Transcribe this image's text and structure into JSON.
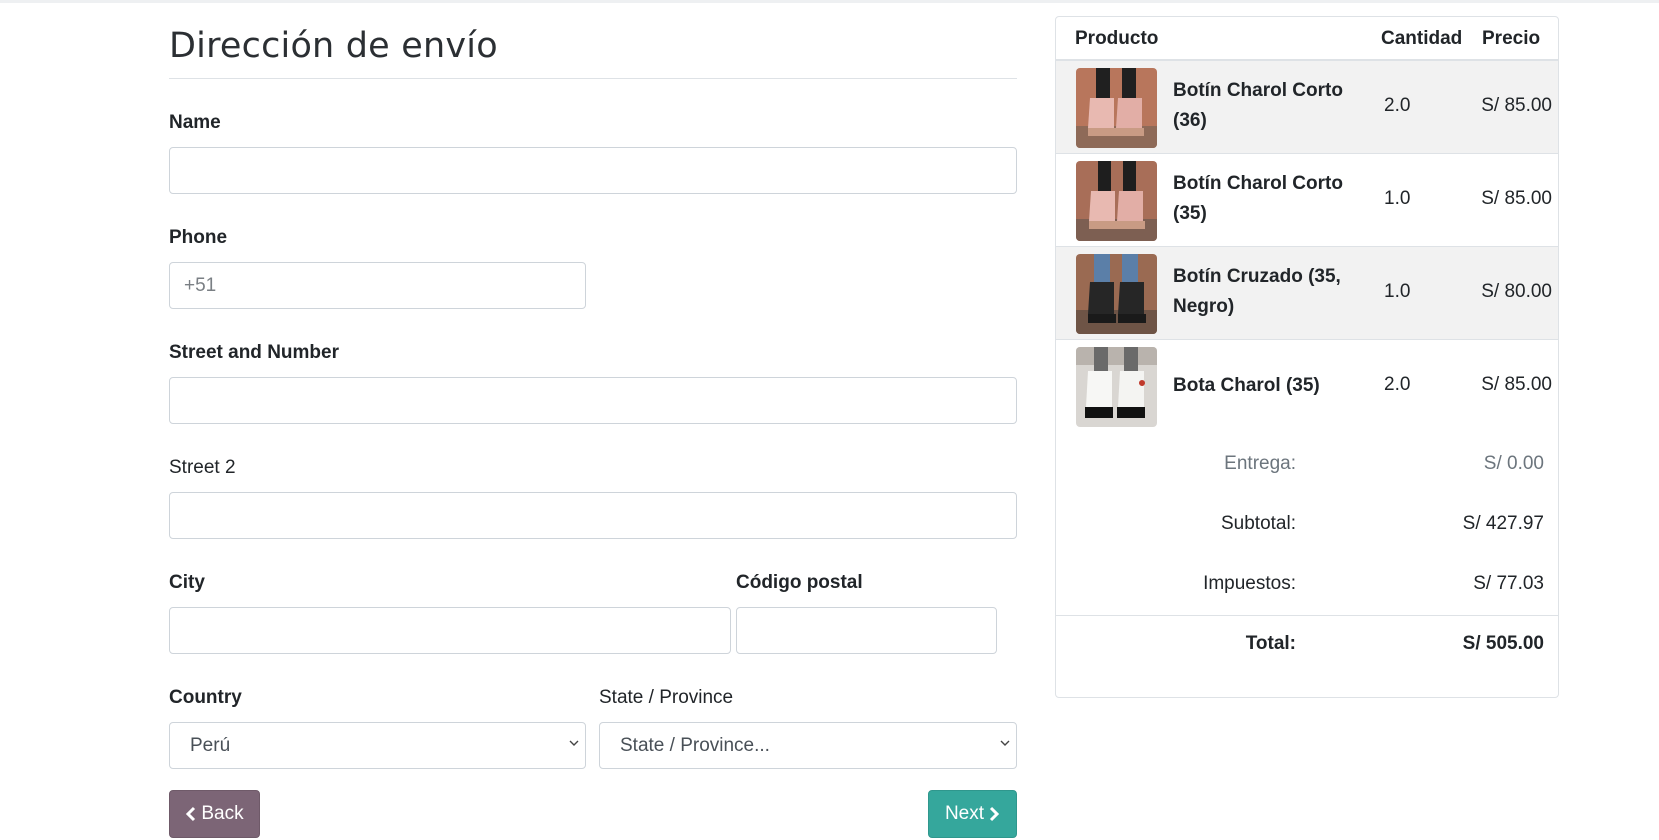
{
  "form": {
    "title": "Dirección de envío",
    "fields": {
      "name": {
        "label": "Name",
        "value": "",
        "placeholder": ""
      },
      "phone": {
        "label": "Phone",
        "value": "",
        "placeholder": "+51"
      },
      "street": {
        "label": "Street and Number",
        "value": "",
        "placeholder": ""
      },
      "street2": {
        "label": "Street 2",
        "value": "",
        "placeholder": ""
      },
      "city": {
        "label": "City",
        "value": "",
        "placeholder": ""
      },
      "zip": {
        "label": "Código postal",
        "value": "",
        "placeholder": ""
      },
      "country": {
        "label": "Country",
        "selected": "Perú"
      },
      "state": {
        "label": "State / Province",
        "selected": "State / Province..."
      }
    },
    "buttons": {
      "back": "Back",
      "next": "Next"
    }
  },
  "cart": {
    "headers": {
      "product": "Producto",
      "quantity": "Cantidad",
      "price": "Precio"
    },
    "items": [
      {
        "name": "Botín Charol Corto (36)",
        "quantity": "2.0",
        "price": "S/ 85.00",
        "image": "pink-boot-thumbnail"
      },
      {
        "name": "Botín Charol Corto (35)",
        "quantity": "1.0",
        "price": "S/ 85.00",
        "image": "pink-boot-thumbnail"
      },
      {
        "name": "Botín Cruzado (35, Negro)",
        "quantity": "1.0",
        "price": "S/ 80.00",
        "image": "black-boot-thumbnail"
      },
      {
        "name": "Bota Charol (35)",
        "quantity": "2.0",
        "price": "S/ 85.00",
        "image": "white-boot-thumbnail"
      }
    ],
    "totals": {
      "delivery": {
        "label": "Entrega:",
        "value": "S/ 0.00"
      },
      "subtotal": {
        "label": "Subtotal:",
        "value": "S/ 427.97"
      },
      "taxes": {
        "label": "Impuestos:",
        "value": "S/ 77.03"
      },
      "total": {
        "label": "Total:",
        "value": "S/ 505.00"
      }
    }
  },
  "colors": {
    "back_button": "#7c6576",
    "next_button": "#35a79c",
    "shaded_row": "#f2f2f2",
    "border": "#dee2e6"
  }
}
